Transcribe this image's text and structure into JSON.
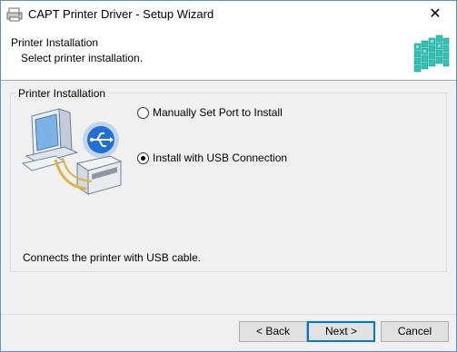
{
  "window": {
    "title": "CAPT Printer Driver - Setup Wizard",
    "close_glyph": "✕"
  },
  "header": {
    "title": "Printer Installation",
    "subtitle": "Select printer installation.",
    "logo_icon": "setup-cubes-icon"
  },
  "group": {
    "legend": "Printer Installation",
    "illustration_icon": "computer-usb-printer-icon",
    "options": [
      {
        "label": "Manually Set Port to Install",
        "checked": false
      },
      {
        "label": "Install with USB Connection",
        "checked": true
      }
    ]
  },
  "description": "Connects the printer with USB cable.",
  "buttons": {
    "back": "< Back",
    "next": "Next >",
    "cancel": "Cancel"
  },
  "colors": {
    "accent": "#0078d7",
    "logo": "#2ec4b6"
  }
}
